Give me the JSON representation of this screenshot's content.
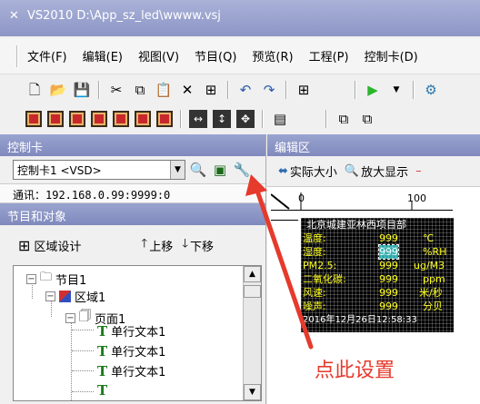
{
  "window": {
    "title": "VS2010 D:\\App_sz_led\\wwww.vsj"
  },
  "menu": [
    "文件(F)",
    "编辑(E)",
    "视图(V)",
    "节目(Q)",
    "预览(R)",
    "工程(P)",
    "控制卡(D)"
  ],
  "left": {
    "control_header": "控制卡",
    "card_select": "控制卡1 <VSD>",
    "status": "通讯：192.168.0.99:9999:0",
    "program_header": "节目和对象",
    "area_design": "区域设计",
    "move_up": "上移",
    "move_down": "下移",
    "tree": {
      "program": "节目1",
      "region": "区域1",
      "page": "页面1",
      "items": [
        "单行文本1",
        "单行文本1",
        "单行文本1"
      ]
    }
  },
  "right": {
    "edit_header": "编辑区",
    "actual_size": "实际大小",
    "zoom_in": "放大显示",
    "ruler_ticks": [
      "0",
      "100"
    ],
    "led": {
      "title": "北京城建亚林西项目部",
      "rows": [
        {
          "label": "温度:",
          "value": "999",
          "unit": "℃"
        },
        {
          "label": "湿度:",
          "value": "999",
          "unit": "%RH"
        },
        {
          "label": "PM2.5:",
          "value": "999",
          "unit": "ug/M3"
        },
        {
          "label": "二氧化碳:",
          "value": "999",
          "unit": "ppm"
        },
        {
          "label": "风速:",
          "value": "999",
          "unit": "米/秒"
        },
        {
          "label": "噪声:",
          "value": "999",
          "unit": "分贝"
        }
      ],
      "datetime": "2016年12月26日12:58:33"
    }
  },
  "annotation": {
    "text": "点此设置",
    "color": "#e53a2c"
  }
}
